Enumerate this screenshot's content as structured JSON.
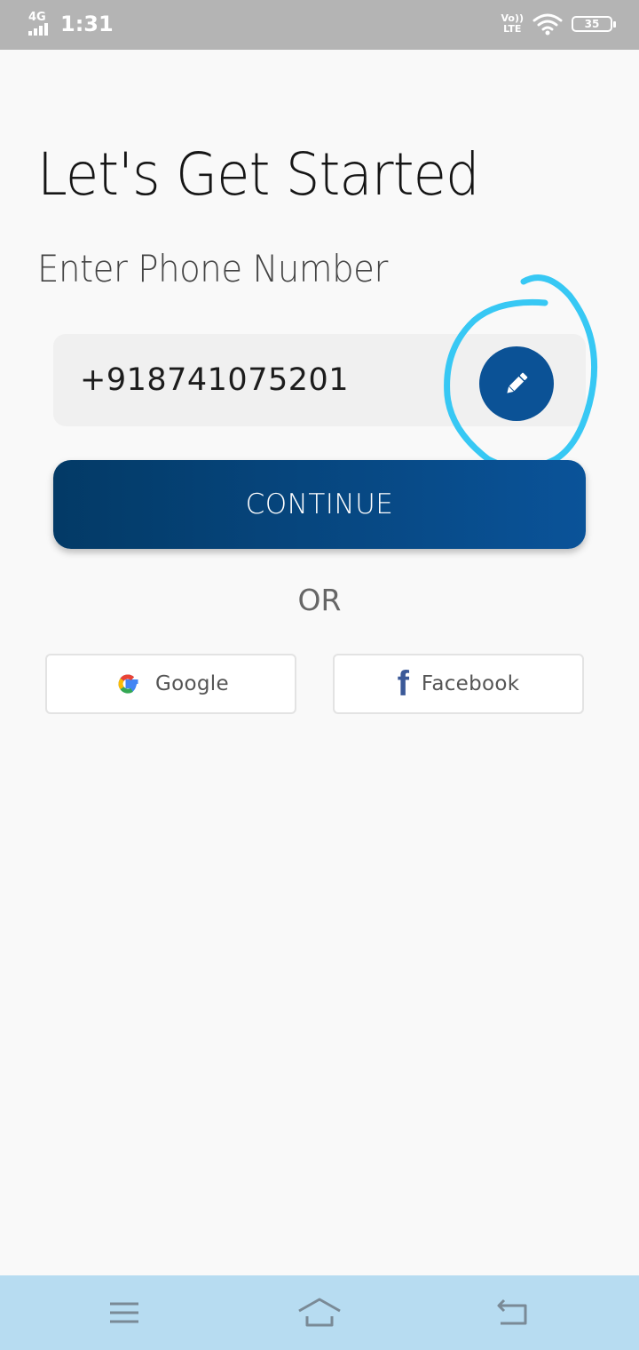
{
  "status_bar": {
    "network": "4G",
    "time": "1:31",
    "volte_top": "Vo))",
    "volte_bottom": "LTE",
    "battery": "35"
  },
  "main": {
    "title": "Let's Get Started",
    "subtitle": "Enter Phone Number",
    "phone_value": "+918741075201",
    "continue_label": "CONTINUE",
    "or_label": "OR"
  },
  "social": {
    "google_label": "Google",
    "facebook_label": "Facebook",
    "facebook_glyph": "f"
  },
  "colors": {
    "accent": "#0b5296",
    "continue_gradient_start": "#033a66",
    "continue_gradient_end": "#0a5399",
    "annotation": "#37c8f4",
    "nav_bar": "#b7dcf1",
    "status_bar": "#b4b4b4"
  },
  "icons": {
    "edit": "pencil-icon",
    "nav_menu": "menu-icon",
    "nav_home": "home-icon",
    "nav_back": "back-icon"
  }
}
